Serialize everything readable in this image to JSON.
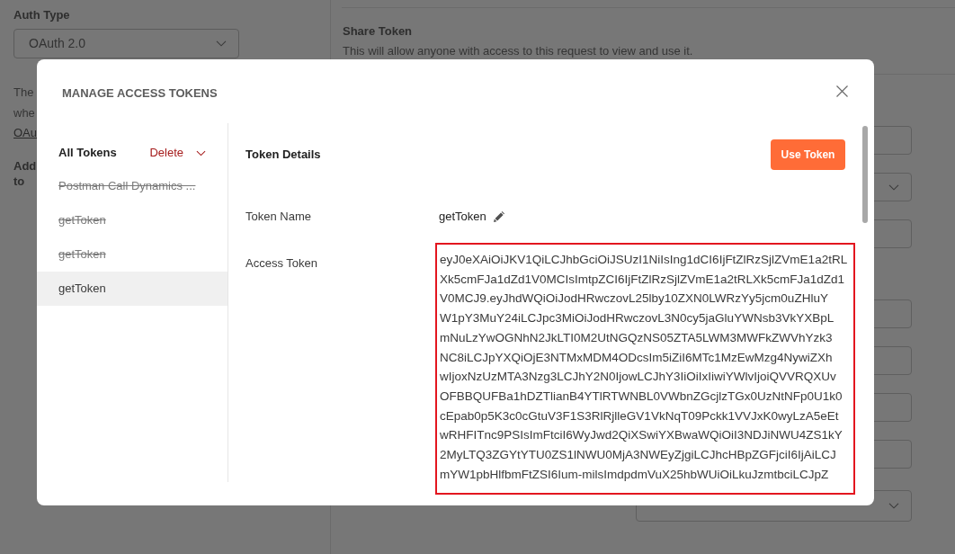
{
  "background": {
    "auth_type": {
      "label": "Auth Type",
      "value": "OAuth 2.0"
    },
    "intro_lines": [
      "The",
      "whe"
    ],
    "intro_link": "OAu",
    "heading_lines": [
      "Add",
      "to"
    ],
    "share_token": {
      "title": "Share Token",
      "description": "This will allow anyone with access to this request to view and use it."
    },
    "field_groups": [
      {
        "fields": [
          {
            "kind": "input"
          },
          {
            "kind": "select"
          },
          {
            "kind": "input"
          }
        ]
      },
      {
        "fields": [
          {
            "kind": "input"
          },
          {
            "kind": "input"
          },
          {
            "kind": "input"
          },
          {
            "kind": "input"
          }
        ]
      }
    ],
    "bottom_select": {
      "kind": "select"
    }
  },
  "modal": {
    "title": "MANAGE ACCESS TOKENS",
    "list_header": "All Tokens",
    "delete_button": "Delete",
    "tokens": [
      {
        "name": "Postman Call Dynamics ...",
        "strikethrough": true,
        "selected": false
      },
      {
        "name": "getToken",
        "strikethrough": true,
        "selected": false
      },
      {
        "name": "getToken",
        "strikethrough": true,
        "selected": false
      },
      {
        "name": "getToken",
        "strikethrough": false,
        "selected": true
      }
    ],
    "details_title": "Token Details",
    "use_token_button": "Use Token",
    "token_name": {
      "label": "Token Name",
      "value": "getToken"
    },
    "access_token": {
      "label": "Access Token",
      "highlighted": true,
      "value_lines": [
        "eyJ0eXAiOiJKV1QiLCJhbGciOiJSUzI1NiIsIng1dCI6IjFtZlRzSjlZVmE1a2tRL",
        "Xk5cmFJa1dZd1V0MCIsImtpZCI6IjFtZlRzSjlZVmE1a2tRLXk5cmFJa1dZd1",
        "V0MCJ9.eyJhdWQiOiJodHRwczovL25lby10ZXN0LWRzYy5jcm0uZHluY",
        "W1pY3MuY24iLCJpc3MiOiJodHRwczovL3N0cy5jaGluYWNsb3VkYXBpL",
        "mNuLzYwOGNhN2JkLTI0M2UtNGQzNS05ZTA5LWM3MWFkZWVhYzk3",
        "NC8iLCJpYXQiOjE3NTMxMDM4ODcsIm5iZiI6MTc1MzEwMzg4NywiZXh",
        "wIjoxNzUzMTA3Nzg3LCJhY2N0IjowLCJhY3IiOiIxIiwiYWlvIjoiQVVRQXUv",
        "OFBBQUFBa1hDZTlianB4YTlRTWNBL0VWbnZGcjlzTGx0UzNtNFp0U1k0",
        "cEpab0p5K3c0cGtuV3F1S3RlRjlleGV1VkNqT09Pckk1VVJxK0wyLzA5eEt",
        "wRHFITnc9PSIsImFtciI6WyJwd2QiXSwiYXBwaWQiOiI3NDJiNWU4ZS1kY",
        "2MyLTQ3ZGYtYTU0ZS1lNWU0MjA3NWEyZjgiLCJhcHBpZGFjciI6IjAiLCJ",
        "mYW1pbHlfbmFtZSI6Ium-milsImdpdmVuX25hbWUiOiLkuJzmtbciLCJpZ"
      ]
    }
  }
}
